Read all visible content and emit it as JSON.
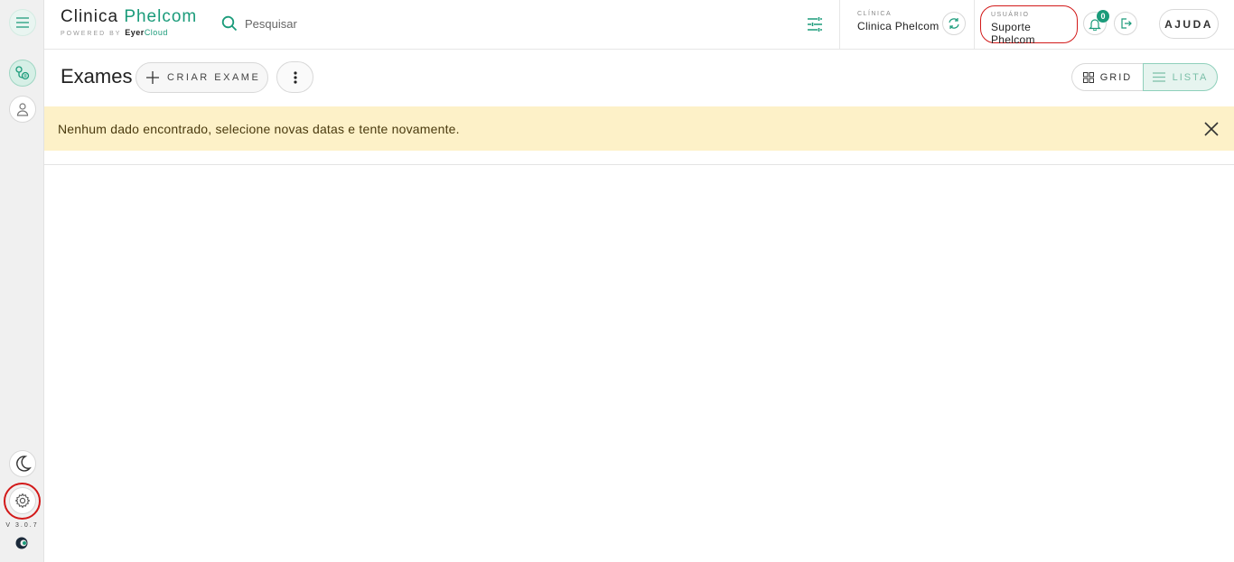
{
  "header": {
    "brand_title_1": "Clinica",
    "brand_title_2": "Phelcom",
    "powered_by": "POWERED BY",
    "powered_brand_1": "Eyer",
    "powered_brand_2": "Cloud",
    "search_placeholder": "Pesquisar",
    "clinic_label": "CLÍNICA",
    "clinic_name": "Clinica Phelcom",
    "user_label": "USUÁRIO",
    "user_name": "Suporte Phelcom",
    "notifications_count": "0",
    "help_label": "AJUDA"
  },
  "sidebar": {
    "version": "V 3.0.7",
    "icons": [
      "menu-icon",
      "exams-icon",
      "patients-icon",
      "moon-icon",
      "gear-icon"
    ]
  },
  "page": {
    "title": "Exames",
    "create_label": "CRIAR EXAME",
    "view_grid_label": "GRID",
    "view_list_label": "LISTA",
    "active_view": "LISTA"
  },
  "alert": {
    "message": "Nenhum dado encontrado, selecione novas datas e tente novamente."
  },
  "colors": {
    "accent": "#1a9b7a",
    "alert_bg": "#fdf1c8",
    "highlight": "#d21919"
  }
}
